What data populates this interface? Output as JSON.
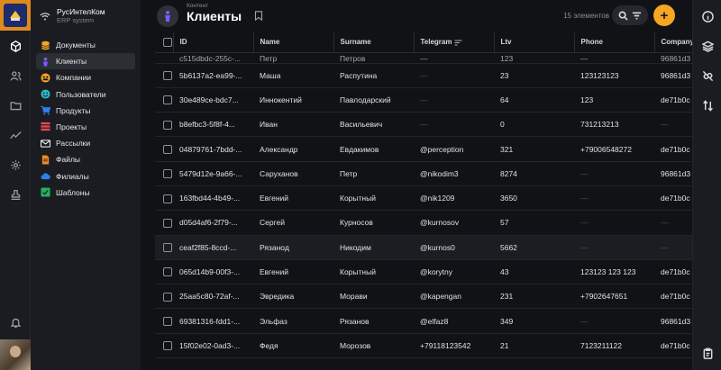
{
  "brand": {
    "name": "РусИнтелКом",
    "subtitle": "ERP system"
  },
  "sidebar": {
    "items": [
      {
        "label": "Документы",
        "icon": "database-icon",
        "color": "#f5a623"
      },
      {
        "label": "Клиенты",
        "icon": "user-icon",
        "color": "#7b5cff",
        "active": true
      },
      {
        "label": "Компании",
        "icon": "users-icon",
        "color": "#f5a623"
      },
      {
        "label": "Пользователи",
        "icon": "smile-icon",
        "color": "#2fb3c6"
      },
      {
        "label": "Продукты",
        "icon": "basket-icon",
        "color": "#2f80ed"
      },
      {
        "label": "Проекты",
        "icon": "list-icon",
        "color": "#e64a4a"
      },
      {
        "label": "Рассылки",
        "icon": "mail-icon",
        "color": "#ffffff"
      },
      {
        "label": "Файлы",
        "icon": "file-icon",
        "color": "#f08a24"
      },
      {
        "label": "Филиалы",
        "icon": "cloud-icon",
        "color": "#2f80ed"
      },
      {
        "label": "Шаблоны",
        "icon": "template-icon",
        "color": "#27ae60"
      }
    ]
  },
  "header": {
    "breadcrumb": "Контент",
    "title": "Клиенты",
    "count": "15 элементов"
  },
  "table": {
    "columns": [
      "ID",
      "Name",
      "Surname",
      "Telegram",
      "Ltv",
      "Phone",
      "Company"
    ],
    "partial_row": [
      "c515dbdc-255c-...",
      "Петр",
      "Петров",
      "—",
      "123",
      "—",
      "96861d3"
    ],
    "rows": [
      [
        "5b6137a2-ea99-...",
        "Маша",
        "Распутина",
        "—",
        "23",
        "123123123",
        "96861d3"
      ],
      [
        "30e489ce-bdc7...",
        "Иннокентий",
        "Павлодарский",
        "—",
        "64",
        "123",
        "de71b0c"
      ],
      [
        "b8efbc3-5f8f-4...",
        "Иван",
        "Васильевич",
        "—",
        "0",
        "731213213",
        "—"
      ],
      [
        "04879761-7bdd-...",
        "Александр",
        "Евдакимов",
        "@perception",
        "321",
        "+79006548272",
        "de71b0c"
      ],
      [
        "5479d12e-9a66-...",
        "Саруханов",
        "Петр",
        "@nikodim3",
        "8274",
        "—",
        "96861d3"
      ],
      [
        "163fbd44-4b49-...",
        "Евгений",
        "Корытный",
        "@nik1209",
        "3650",
        "—",
        "de71b0c"
      ],
      [
        "d05d4af6-2f79-...",
        "Сергей",
        "Курносов",
        "@kurnosov",
        "57",
        "—",
        "—"
      ],
      [
        "ceaf2f85-8ccd-...",
        "Рязанод",
        "Никодим",
        "@kurnos0",
        "5662",
        "—",
        "—"
      ],
      [
        "065d14b9-00f3-...",
        "Евгений",
        "Корытный",
        "@korytny",
        "43",
        "123123 123 123",
        "de71b0c"
      ],
      [
        "25aa5c80-72af-...",
        "Эвредика",
        "Морави",
        "@kapengan",
        "231",
        "+7902647651",
        "de71b0c"
      ],
      [
        "69381316-fdd1-...",
        "Эльфаз",
        "Рязанов",
        "@elfaz8",
        "349",
        "—",
        "96861d3"
      ],
      [
        "15f02e02-0ad3-...",
        "Федя",
        "Морозов",
        "+79118123542",
        "21",
        "7123211122",
        "de71b0c"
      ]
    ],
    "highlighted_row_index": 7
  },
  "colors": {
    "accent": "#f5a623",
    "background": "#111216",
    "panel": "#1b1c21"
  }
}
